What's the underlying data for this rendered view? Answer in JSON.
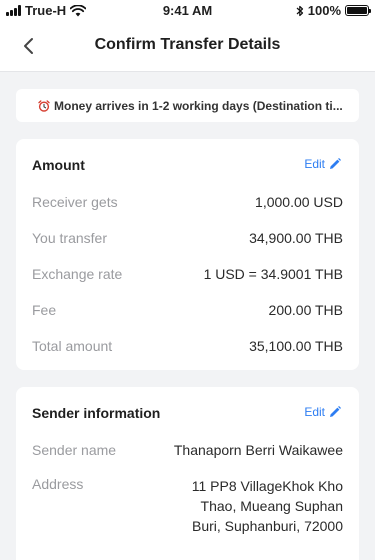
{
  "status_bar": {
    "carrier": "True-H",
    "time": "9:41 AM",
    "battery": "100%",
    "battery_level": 1.0
  },
  "header": {
    "title": "Confirm Transfer Details"
  },
  "notice": {
    "text": "Money arrives in 1-2 working days (Destination ti..."
  },
  "amount_card": {
    "title": "Amount",
    "edit_label": "Edit",
    "rows": [
      {
        "label": "Receiver gets",
        "value": "1,000.00 USD"
      },
      {
        "label": "You transfer",
        "value": "34,900.00 THB"
      },
      {
        "label": "Exchange rate",
        "value": "1 USD = 34.9001 THB"
      },
      {
        "label": "Fee",
        "value": "200.00 THB"
      },
      {
        "label": "Total amount",
        "value": "35,100.00 THB"
      }
    ]
  },
  "sender_card": {
    "title": "Sender information",
    "edit_label": "Edit",
    "name_label": "Sender name",
    "name_value": "Thanaporn Berri Waikawee",
    "address_label": "Address",
    "address_value": "11 PP8 VillageKhok Kho Thao, Mueang Suphan Buri, Suphanburi, 72000"
  },
  "colors": {
    "accent": "#2d7df2",
    "background": "#f2f3f5",
    "label": "#9a9b9f"
  }
}
